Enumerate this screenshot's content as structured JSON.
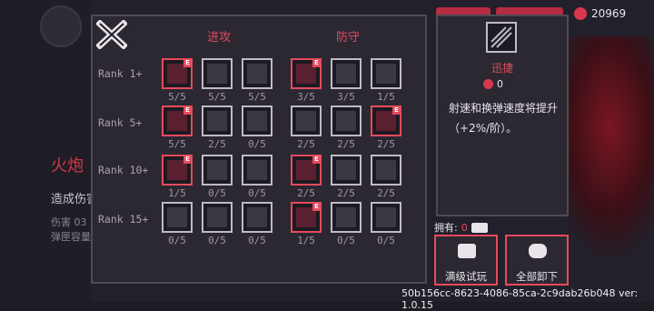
{
  "currency": {
    "icon": "yinyang-coin-icon",
    "amount": "20969"
  },
  "background": {
    "title": "火炮",
    "line1": "造成伤害",
    "line2": "伤害 03",
    "line3": "弹匣容量"
  },
  "columns": {
    "attack": "进攻",
    "defense": "防守"
  },
  "ranks": [
    "Rank 1+",
    "Rank 5+",
    "Rank 10+",
    "Rank 15+"
  ],
  "grid": [
    [
      {
        "icon": "diagonal-stripes-icon",
        "count": "5/5",
        "selected": true,
        "elite": true
      },
      {
        "icon": "spiral-icon",
        "count": "5/5",
        "selected": false,
        "elite": false
      },
      {
        "icon": "fist-icon",
        "count": "5/5",
        "selected": false,
        "elite": false
      },
      {
        "icon": "shield-e-icon",
        "count": "3/5",
        "selected": true,
        "elite": true
      },
      {
        "icon": "running-figure-icon",
        "count": "3/5",
        "selected": false,
        "elite": false
      },
      {
        "icon": "heart-shield-icon",
        "count": "1/5",
        "selected": false,
        "elite": false
      }
    ],
    [
      {
        "icon": "arrow-burst-icon",
        "count": "5/5",
        "selected": true,
        "elite": true
      },
      {
        "icon": "claw-icon",
        "count": "2/5",
        "selected": false,
        "elite": false
      },
      {
        "icon": "wave-icon",
        "count": "0/5",
        "selected": false,
        "elite": false
      },
      {
        "icon": "ring-icon",
        "count": "2/5",
        "selected": false,
        "elite": false
      },
      {
        "icon": "boot-icon",
        "count": "2/5",
        "selected": false,
        "elite": false
      },
      {
        "icon": "leaf-icon",
        "count": "2/5",
        "selected": true,
        "elite": true
      }
    ],
    [
      {
        "icon": "potion-icon",
        "count": "1/5",
        "selected": true,
        "elite": true
      },
      {
        "icon": "triangle-rune-icon",
        "count": "0/5",
        "selected": false,
        "elite": false
      },
      {
        "icon": "explosion-icon",
        "count": "0/5",
        "selected": false,
        "elite": false
      },
      {
        "icon": "shield-figure-icon",
        "count": "2/5",
        "selected": true,
        "elite": true
      },
      {
        "icon": "sparkle-heart-icon",
        "count": "2/5",
        "selected": false,
        "elite": false
      },
      {
        "icon": "crescent-figure-icon",
        "count": "2/5",
        "selected": false,
        "elite": false
      }
    ],
    [
      {
        "icon": "locked-bird-icon",
        "count": "0/5",
        "selected": false,
        "elite": false
      },
      {
        "icon": "locked-mask-icon",
        "count": "0/5",
        "selected": false,
        "elite": false
      },
      {
        "icon": "locked-claw-icon",
        "count": "0/5",
        "selected": false,
        "elite": false
      },
      {
        "icon": "heart-cross-icon",
        "count": "1/5",
        "selected": true,
        "elite": true
      },
      {
        "icon": "locked-wings-icon",
        "count": "0/5",
        "selected": false,
        "elite": false
      },
      {
        "icon": "locked-hands-icon",
        "count": "0/5",
        "selected": false,
        "elite": false
      }
    ]
  ],
  "info": {
    "name": "迅捷",
    "level": "0",
    "desc": "射速和换弹速度将提升（+2%/阶）。"
  },
  "owned": {
    "label": "拥有:",
    "value": "0"
  },
  "buttons": {
    "trial": "满级试玩",
    "unequip": "全部卸下"
  },
  "version": "50b156cc-8623-4086-85ca-2c9dab26b048 ver: 1.0.15"
}
